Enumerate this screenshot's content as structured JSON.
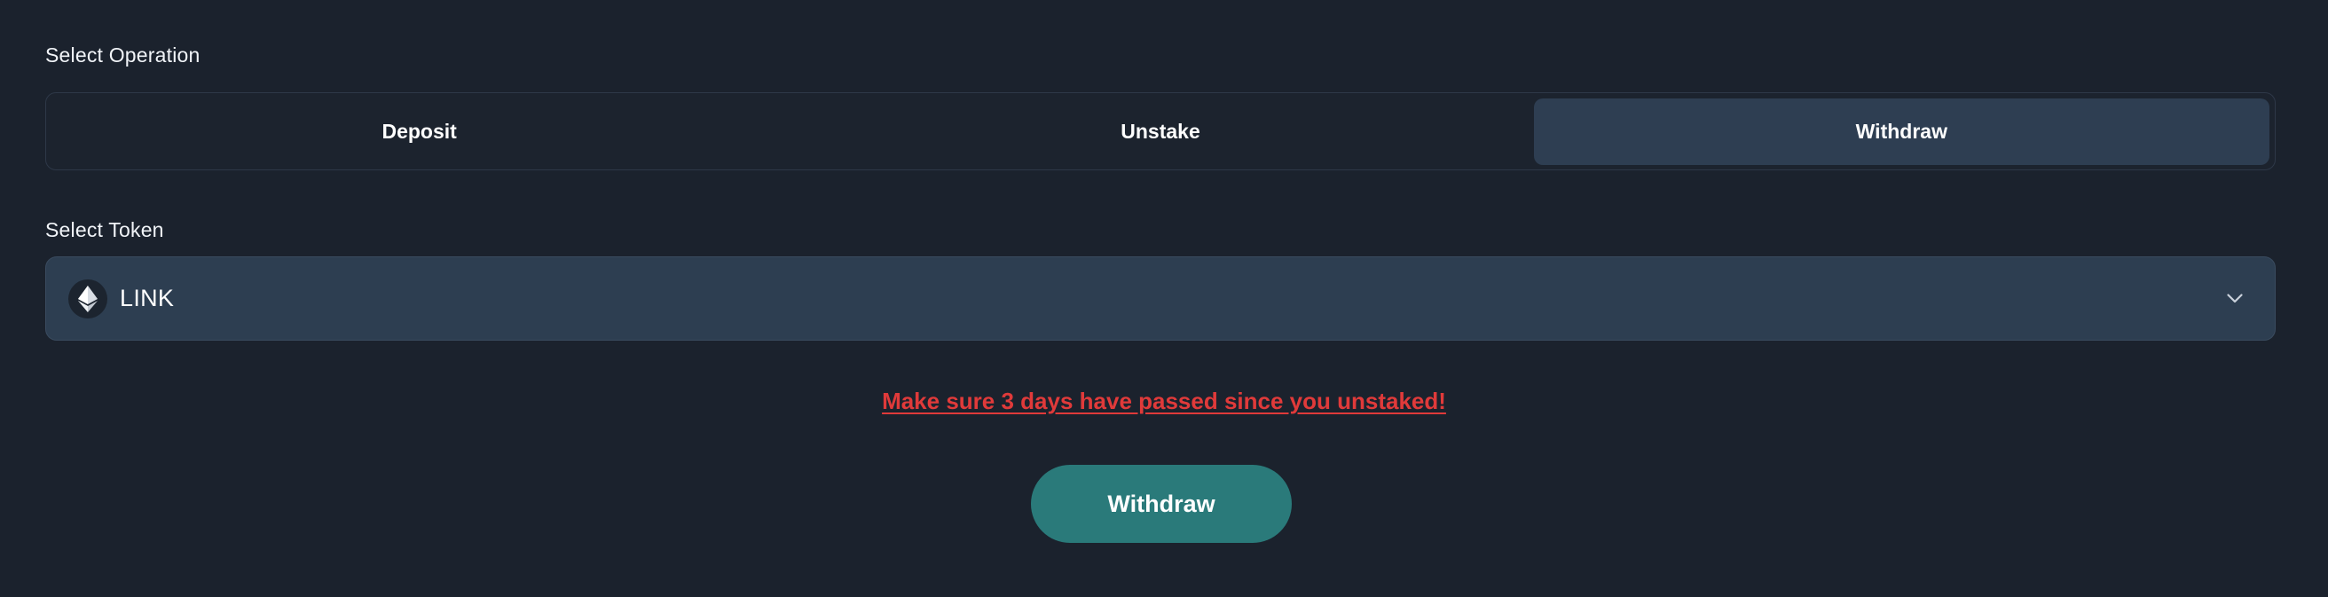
{
  "operation": {
    "label": "Select Operation",
    "options": [
      {
        "label": "Deposit",
        "active": false
      },
      {
        "label": "Unstake",
        "active": false
      },
      {
        "label": "Withdraw",
        "active": true
      }
    ]
  },
  "token": {
    "label": "Select Token",
    "selected": "LINK",
    "icon": "ethereum-icon"
  },
  "warning": "Make sure 3 days have passed since you unstaked!",
  "submit_label": "Withdraw",
  "colors": {
    "background": "#1b222d",
    "active_segment": "#2e3e52",
    "select_background": "#2d3e51",
    "warning": "#e03a3a",
    "primary_button": "#2a7a7a"
  }
}
